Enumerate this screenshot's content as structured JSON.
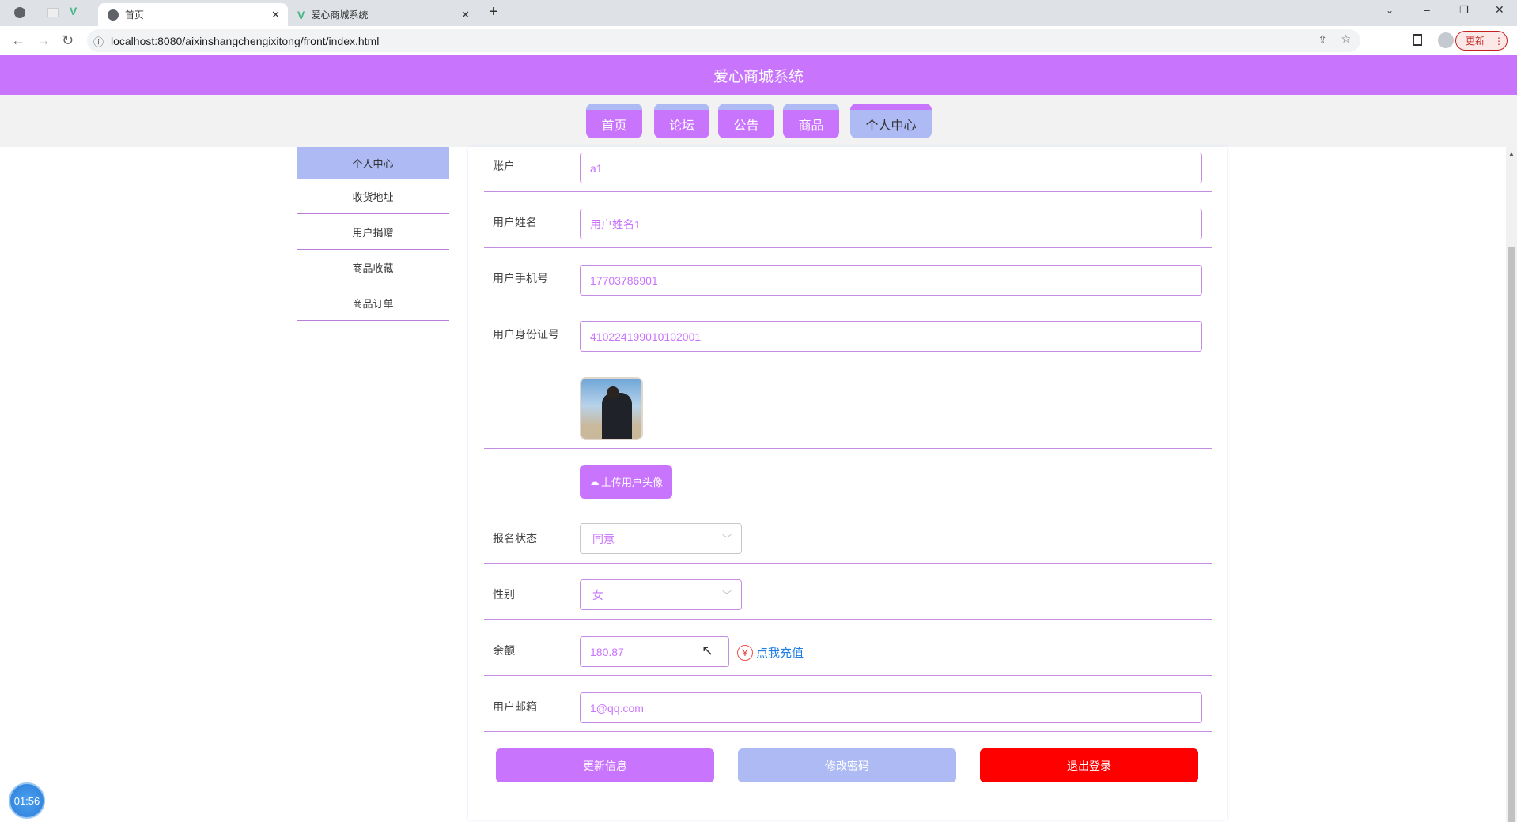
{
  "browser": {
    "tabs": [
      {
        "label": "首页"
      },
      {
        "label": "爱心商城系统"
      }
    ],
    "url": "localhost:8080/aixinshangchengixitong/front/index.html",
    "update_label": "更新"
  },
  "header": {
    "title": "爱心商城系统"
  },
  "nav": [
    {
      "label": "首页"
    },
    {
      "label": "论坛"
    },
    {
      "label": "公告"
    },
    {
      "label": "商品"
    },
    {
      "label": "个人中心"
    }
  ],
  "sidebar": [
    {
      "label": "个人中心"
    },
    {
      "label": "收货地址"
    },
    {
      "label": "用户捐赠"
    },
    {
      "label": "商品收藏"
    },
    {
      "label": "商品订单"
    }
  ],
  "form": {
    "account": {
      "label": "账户",
      "value": "a1"
    },
    "name": {
      "label": "用户姓名",
      "value": "用户姓名1"
    },
    "phone": {
      "label": "用户手机号",
      "value": "17703786901"
    },
    "idcard": {
      "label": "用户身份证号",
      "value": "410224199010102001"
    },
    "upload_label": "上传用户头像",
    "status": {
      "label": "报名状态",
      "value": "同意"
    },
    "gender": {
      "label": "性别",
      "value": "女"
    },
    "balance": {
      "label": "余额",
      "value": "180.87",
      "recharge": "点我充值"
    },
    "email": {
      "label": "用户邮箱",
      "value": "1@qq.com"
    }
  },
  "actions": {
    "update": "更新信息",
    "password": "修改密码",
    "logout": "退出登录"
  },
  "timer": "01:56",
  "colors": {
    "primary": "#c974fd",
    "secondary": "#adbaf4",
    "danger": "#ff0000"
  }
}
